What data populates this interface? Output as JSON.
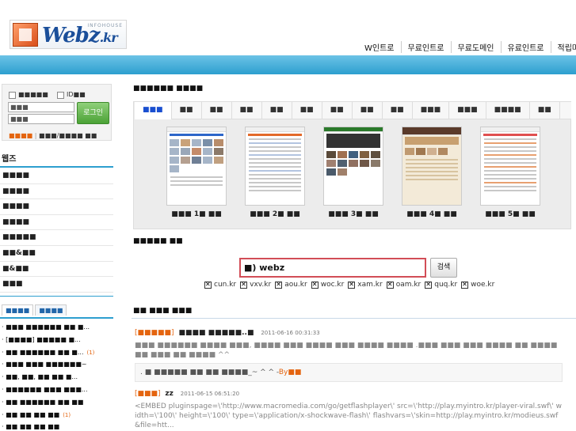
{
  "header": {
    "logo_text": "Webz",
    "logo_tld": ".kr",
    "logo_sub": "INFOHOUSE",
    "nav": [
      "W인트로",
      "무료인트로",
      "무료도메인",
      "유료인트로",
      "적립마케팅"
    ]
  },
  "login": {
    "save_id_label": "■■■■■",
    "id_label": "ID■■",
    "id_placeholder": "■■■",
    "pw_placeholder": "■■■",
    "button": "로그인",
    "join_link": "■■■■",
    "find_link": "■■■/■■■■ ■■"
  },
  "sidebar": {
    "title": "웹즈",
    "menu": [
      "■■■■",
      "■■■■",
      "■■■■",
      "■■■■",
      "■■■■■",
      "■■&■■",
      "■&■■",
      "■■■"
    ],
    "tabs": [
      "■■■■",
      "■■■■"
    ],
    "list": [
      {
        "text": "· ■■■ ■■■■■■ ■■ ■...",
        "count": ""
      },
      {
        "text": "· [■■■■] ■■■■■ ■...",
        "count": ""
      },
      {
        "text": "· ■■ ■■■■■■ ■■ ■...",
        "count": "(1)"
      },
      {
        "text": "· ■■■ ■■■ ■■■■■■~",
        "count": ""
      },
      {
        "text": "· ■■, ■■, ■■ ■■ ■...",
        "count": ""
      },
      {
        "text": "· ■■■■■■ ■■■ ■■■...",
        "count": ""
      },
      {
        "text": "· ■■ ■■■■■■ ■■ ■■",
        "count": ""
      },
      {
        "text": "· ■■ ■■ ■■ ■■",
        "count": "(1)"
      },
      {
        "text": "· ■■ ■■ ■■ ■■",
        "count": ""
      }
    ]
  },
  "gallery": {
    "title": "■■■■■■ ■■■■",
    "tabs": [
      "■■■",
      "■■",
      "■■",
      "■■",
      "■■",
      "■■",
      "■■",
      "■■",
      "■■",
      "■■■",
      "■■■",
      "■■■■",
      "■■"
    ],
    "items": [
      {
        "label": "■■■ 1■ ■■"
      },
      {
        "label": "■■■ 2■ ■■"
      },
      {
        "label": "■■■ 3■ ■■"
      },
      {
        "label": "■■■ 4■ ■■"
      },
      {
        "label": "■■■ 5■ ■■"
      }
    ]
  },
  "domain_search": {
    "title": "■■■■■ ■■",
    "input_value": "■) webz",
    "button": "검색",
    "tlds": [
      "cun.kr",
      "vxv.kr",
      "aou.kr",
      "woc.kr",
      "xam.kr",
      "oam.kr",
      "quq.kr",
      "woe.kr"
    ]
  },
  "posts": {
    "title": "■■ ■■■ ■■■",
    "items": [
      {
        "tag": "■■■■■",
        "title": "■■■■ ■■■■■..■",
        "date": "2011-06-16 00:31:33",
        "body": "■■■ ■■■■■■ ■■■■ ■■■, ■■■■ ■■■ ■■■■ ■■■ ■■■■ ■■■■ .■■■ ■■■ ■■■ ■■■■ ■■ ■■■■ ■■ ■■■ ■■ ■■■■ ^^",
        "reply": ". ■ ■■■■■ ■■ ■■ ■■■■_~ ^ ^ -",
        "reply_by": "By■■"
      },
      {
        "tag": "■■■",
        "title": "zz",
        "date": "2011-06-15 06:51:20",
        "body": "<EMBED pluginspage=\\'http://www.macromedia.com/go/getflashplayer\\' src=\\'http://play.myintro.kr/player-viral.swf\\' width=\\'100\\' height=\\'100\\' type=\\'application/x-shockwave-flash\\' flashvars=\\'skin=http://play.myintro.kr/modieus.swf&file=htt..."
      }
    ]
  },
  "colors": {
    "accent_blue": "#2d9fcf",
    "accent_orange": "#e4640f",
    "search_border": "#d24d57",
    "login_button": "#4ba236"
  }
}
